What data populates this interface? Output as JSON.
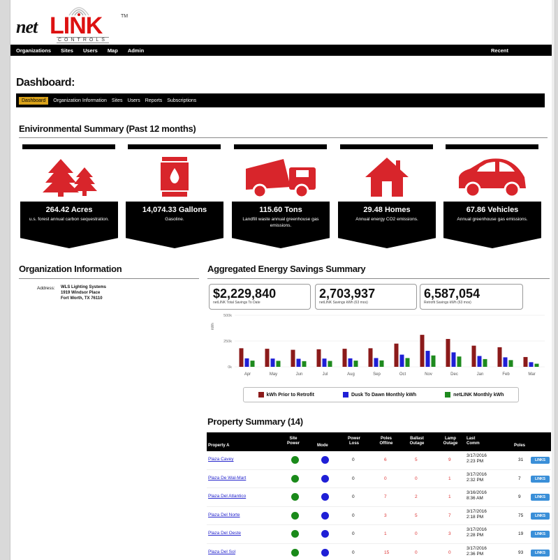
{
  "brand": {
    "prefix": "net",
    "name": "LINK",
    "tm": "TM",
    "sub": "CONTROLS"
  },
  "topnav": {
    "items": [
      "Organizations",
      "Sites",
      "Users",
      "Map",
      "Admin"
    ],
    "recent": "Recent"
  },
  "page_title": "Dashboard:",
  "subnav": {
    "items": [
      "Dashboard",
      "Organization Information",
      "Sites",
      "Users",
      "Reports",
      "Subscriptions"
    ]
  },
  "env": {
    "title": "Enivironmental Summary (Past 12 months)",
    "tiles": [
      {
        "icon": "trees-icon",
        "value": "264.42 Acres",
        "desc": "u.s. forest annual carbon sequestration."
      },
      {
        "icon": "fuel-barrel-icon",
        "value": "14,074.33 Gallons",
        "desc": "Gasoline."
      },
      {
        "icon": "garbage-truck-icon",
        "value": "115.60 Tons",
        "desc": "Landfill waste annual greenhouse gas emissions."
      },
      {
        "icon": "house-icon",
        "value": "29.48 Homes",
        "desc": "Annual energy CO2 emissions."
      },
      {
        "icon": "car-icon",
        "value": "67.86 Vehicles",
        "desc": "Annual greenhouse gas emissions."
      }
    ],
    "accent": "#d8252b"
  },
  "org": {
    "title": "Organization Information",
    "address_label": "Address:",
    "address_lines": [
      "WLS Lighting Systems",
      "1919 Windsor Place",
      "Fort Worth, TX 76110"
    ]
  },
  "savings": {
    "title": "Aggregated Energy Savings Summary",
    "boxes": [
      {
        "value": "$2,229,840",
        "caption": "netLINK Total Savings To Date"
      },
      {
        "value": "2,703,937",
        "caption": "netLINK Savings kWh (63 mos)"
      },
      {
        "value": "6,587,054",
        "caption": "Retrofit Savings kWh (63 mos)"
      }
    ]
  },
  "chart_data": {
    "type": "bar",
    "categories": [
      "Apr",
      "May",
      "Jun",
      "Jul",
      "Aug",
      "Sep",
      "Oct",
      "Nov",
      "Dec",
      "Jan",
      "Feb",
      "Mar"
    ],
    "series": [
      {
        "name": "kWh Prior to Retrofit",
        "color": "#8b1a1a",
        "values": [
          180000,
          175000,
          165000,
          170000,
          175000,
          180000,
          225000,
          310000,
          270000,
          205000,
          190000,
          95000
        ]
      },
      {
        "name": "Dusk To Dawn Monthly kWh",
        "color": "#1f1fd6",
        "values": [
          82000,
          80000,
          78000,
          80000,
          82000,
          85000,
          118000,
          155000,
          140000,
          105000,
          92000,
          45000
        ]
      },
      {
        "name": "netLINK Monthly kWh",
        "color": "#1e8a1e",
        "values": [
          60000,
          58000,
          55000,
          57000,
          60000,
          62000,
          85000,
          110000,
          100000,
          75000,
          65000,
          30000
        ]
      }
    ],
    "yticks": [
      "500k",
      "250k",
      "0k"
    ],
    "ylabel": "kWh",
    "ylim": [
      0,
      500000
    ]
  },
  "property": {
    "title": "Property Summary (14)",
    "headers": [
      "Property A",
      "Site Power",
      "Mode",
      "Power Loss",
      "Poles Offline",
      "Ballast Outage",
      "Lamp Outage",
      "Last Comm",
      "Poles"
    ],
    "link_label": "LINKS",
    "rows": [
      {
        "name": "Plaza Cavey",
        "power_loss": "0",
        "poles_offline": "6",
        "ballast": "5",
        "lamp": "9",
        "last_comm": "3/17/2016 2:23 PM",
        "poles": "31"
      },
      {
        "name": "Plaza De Wal-Mart",
        "power_loss": "0",
        "poles_offline": "0",
        "ballast": "0",
        "lamp": "1",
        "last_comm": "3/17/2016 2:32 PM",
        "poles": "7"
      },
      {
        "name": "Plaza Del Atlantico",
        "power_loss": "0",
        "poles_offline": "7",
        "ballast": "2",
        "lamp": "1",
        "last_comm": "3/16/2016 8:36 AM",
        "poles": "9"
      },
      {
        "name": "Plaza Del Norte",
        "power_loss": "0",
        "poles_offline": "3",
        "ballast": "5",
        "lamp": "7",
        "last_comm": "3/17/2016 2:18 PM",
        "poles": "75"
      },
      {
        "name": "Plaza Del Oeste",
        "power_loss": "0",
        "poles_offline": "1",
        "ballast": "0",
        "lamp": "3",
        "last_comm": "3/17/2016 2:28 PM",
        "poles": "19"
      },
      {
        "name": "Plaza Del Sol",
        "power_loss": "0",
        "poles_offline": "15",
        "ballast": "0",
        "lamp": "0",
        "last_comm": "3/17/2016 2:36 PM",
        "poles": "93"
      }
    ]
  }
}
